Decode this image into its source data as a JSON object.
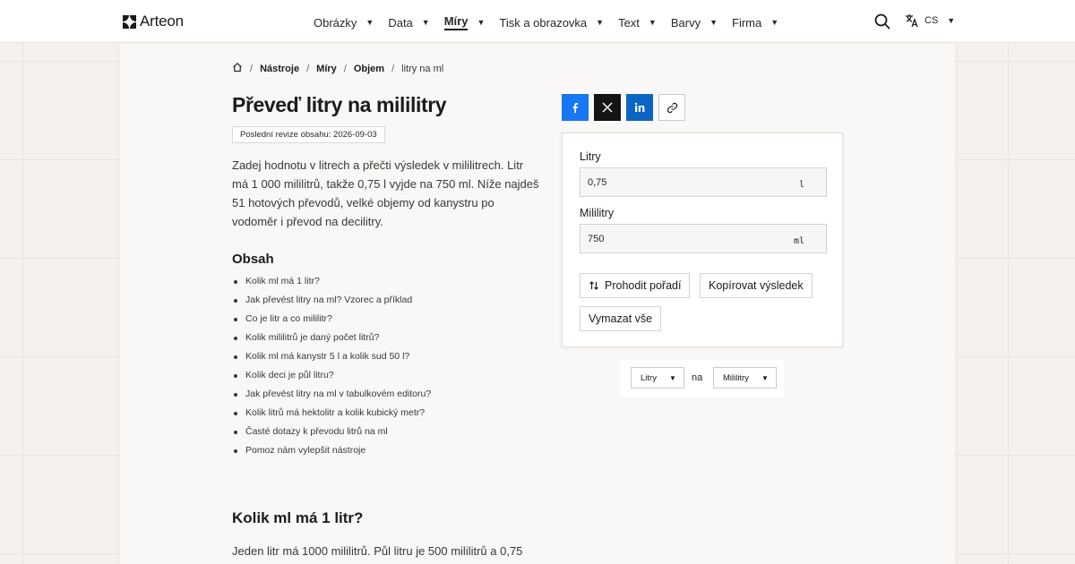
{
  "brand": {
    "name": "Arteon"
  },
  "nav": {
    "items": [
      {
        "label": "Obrázky",
        "active": false
      },
      {
        "label": "Data",
        "active": false
      },
      {
        "label": "Míry",
        "active": true
      },
      {
        "label": "Tisk a obrazovka",
        "active": false
      },
      {
        "label": "Text",
        "active": false
      },
      {
        "label": "Barvy",
        "active": false
      },
      {
        "label": "Firma",
        "active": false
      }
    ],
    "caret": "▼",
    "language": "CS"
  },
  "breadcrumb": {
    "items": [
      "Nástroje",
      "Míry",
      "Objem"
    ],
    "current": "litry na ml",
    "separator": "/"
  },
  "page": {
    "title": "Převeď litry na mililitry",
    "revision": "Poslední revize obsahu: 2026-09-03",
    "intro": "Zadej hodnotu v litrech a přečti výsledek v mililitrech. Litr má 1 000 mililitrů, takže 0,75 l vyjde na 750 ml. Níže najdeš 51 hotových převodů, velké objemy od kanystru po vodoměr i převod na decilitry."
  },
  "toc": {
    "title": "Obsah",
    "items": [
      "Kolik ml má 1 litr?",
      "Jak převést litry na ml? Vzorec a příklad",
      "Co je litr a co mililitr?",
      "Kolik mililitrů je daný počet litrů?",
      "Kolik ml má kanystr 5 l a kolik sud 50 l?",
      "Kolik deci je půl litru?",
      "Jak převést litry na ml v tabulkovém editoru?",
      "Kolik litrů má hektolitr a kolik kubický metr?",
      "Časté dotazy k převodu litrů na ml",
      "Pomoz nám vylepšit nástroje"
    ]
  },
  "section": {
    "title": "Kolik ml má 1 litr?",
    "text": "Jeden litr má 1000 mililitrů. Půl litru je 500 mililitrů a 0,75"
  },
  "converter": {
    "from": {
      "label": "Litry",
      "value": "0,75",
      "unit": "l"
    },
    "to": {
      "label": "Mililitry",
      "value": "750",
      "unit": "ml"
    },
    "swap_label": "Prohodit pořadí",
    "copy_label": "Kopírovat výsledek",
    "clear_label": "Vymazat vše"
  },
  "unit_bar": {
    "from_unit": "Litry",
    "connector": "na",
    "to_unit": "Mililitry"
  },
  "colors": {
    "facebook": "#1877f2",
    "x": "#141414",
    "linkedin": "#0a66c2"
  }
}
